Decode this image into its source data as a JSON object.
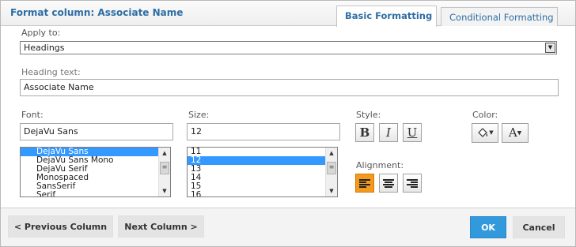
{
  "dialog": {
    "title": "Format column: Associate Name",
    "tabs": [
      {
        "label": "Basic Formatting",
        "active": true
      },
      {
        "label": "Conditional Formatting",
        "active": false
      }
    ]
  },
  "apply_to": {
    "label": "Apply to:",
    "value": "Headings"
  },
  "heading_text": {
    "label": "Heading text:",
    "value": "Associate Name"
  },
  "font": {
    "label": "Font:",
    "value": "DejaVu Sans",
    "options": [
      "DejaVu Sans",
      "DejaVu Sans Mono",
      "DejaVu Serif",
      "Monospaced",
      "SansSerif",
      "Serif"
    ],
    "selected_index": 0
  },
  "size": {
    "label": "Size:",
    "value": "12",
    "options": [
      "11",
      "12",
      "13",
      "14",
      "15",
      "16"
    ],
    "selected_index": 1
  },
  "style": {
    "label": "Style:",
    "bold": "B",
    "italic": "I",
    "underline": "U"
  },
  "color": {
    "label": "Color:",
    "text_glyph": "A"
  },
  "alignment": {
    "label": "Alignment:",
    "active": "left",
    "accent": "#f39a1e"
  },
  "footer": {
    "previous_label": "< Previous Column",
    "next_label": "Next Column >",
    "ok_label": "OK",
    "cancel_label": "Cancel"
  },
  "colors": {
    "title": "#2e6da4",
    "ok_button": "#3399dd",
    "list_selection": "#3399ff"
  }
}
